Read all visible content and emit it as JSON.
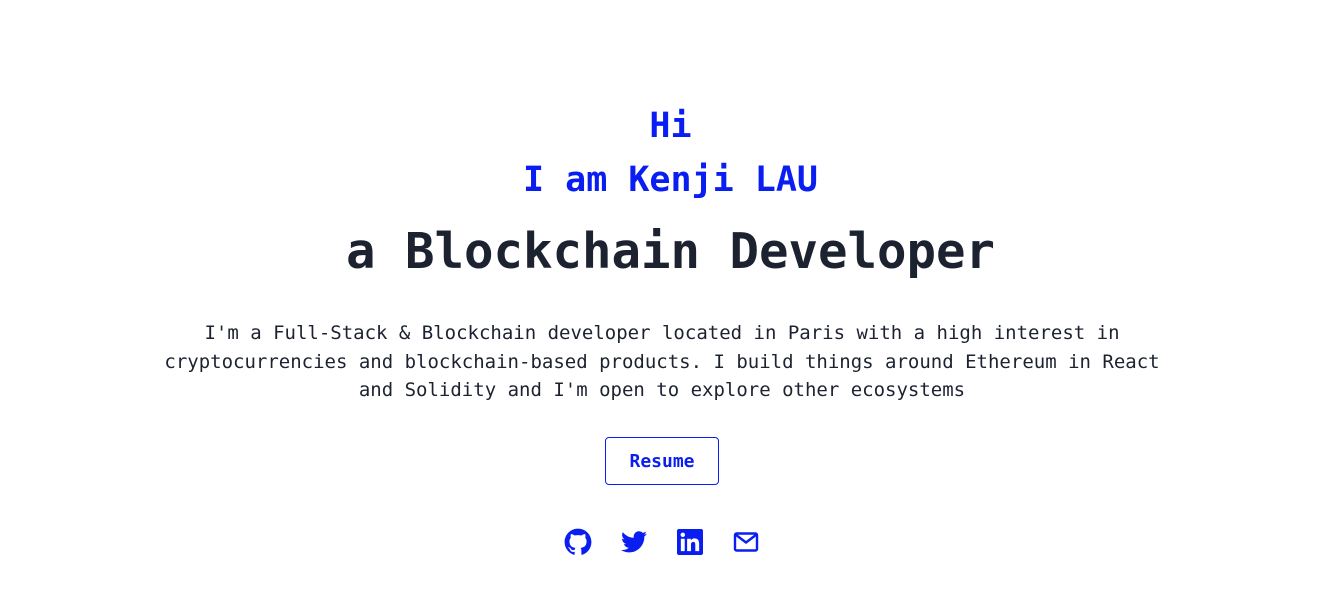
{
  "hero": {
    "greeting": "Hi",
    "name_line": "I am Kenji LAU",
    "role_line": "a Blockchain Developer",
    "bio": "I'm a Full-Stack & Blockchain developer located in Paris with a high interest in cryptocurrencies and blockchain-based products. I build things around Ethereum in React and Solidity and I'm open to explore other ecosystems",
    "resume_label": "Resume"
  },
  "socials": [
    {
      "icon": "github-icon"
    },
    {
      "icon": "twitter-icon"
    },
    {
      "icon": "linkedin-icon"
    },
    {
      "icon": "email-icon"
    }
  ],
  "colors": {
    "accent": "#0a1ef2",
    "text": "#1c2230",
    "background": "#ffffff"
  }
}
